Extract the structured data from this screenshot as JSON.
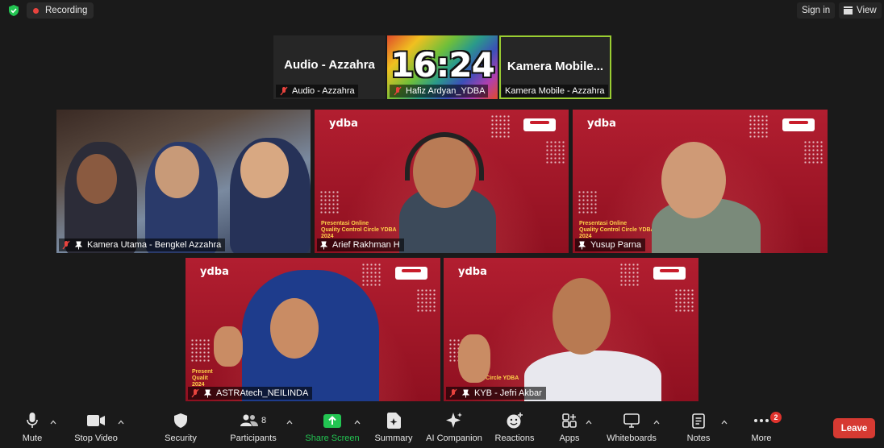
{
  "topbar": {
    "recording_label": "Recording",
    "signin_label": "Sign in",
    "view_label": "View"
  },
  "thumbnails": [
    {
      "display": "Audio - Azzahra",
      "name": "Audio - Azzahra"
    },
    {
      "display": "16:24",
      "name": "Hafiz Ardyan_YDBA"
    },
    {
      "display": "Kamera Mobile...",
      "name": "Kamera Mobile - Azzahra"
    }
  ],
  "tiles": [
    {
      "name": "Kamera Utama - Bengkel Azzahra"
    },
    {
      "name": "Arief Rakhman H",
      "brand": "ydba",
      "caption": "Presentasi Online\nQuality Control Circle YDBA\n2024"
    },
    {
      "name": "Yusup Parna",
      "brand": "ydba",
      "caption": "Presentasi Online\nQuality Control Circle YDBA\n2024"
    },
    {
      "name": "ASTRAtech_NEILINDA",
      "brand": "ydba",
      "caption": "Present\nQualit\n2024"
    },
    {
      "name": "KYB - Jefri Akbar",
      "brand": "ydba",
      "caption": "ol Circle YDBA"
    }
  ],
  "toolbar": {
    "mute": "Mute",
    "stop_video": "Stop Video",
    "security": "Security",
    "participants": "Participants",
    "participants_count": "8",
    "share_screen": "Share Screen",
    "summary": "Summary",
    "ai_companion": "AI Companion",
    "reactions": "Reactions",
    "apps": "Apps",
    "whiteboards": "Whiteboards",
    "notes": "Notes",
    "more": "More",
    "more_badge": "2",
    "leave": "Leave"
  },
  "colors": {
    "background": "#1a1a1a",
    "accent_green": "#23c552",
    "leave_red": "#d63a32",
    "slide_red": "#a7182a",
    "active_speaker_border": "#9acd32"
  }
}
